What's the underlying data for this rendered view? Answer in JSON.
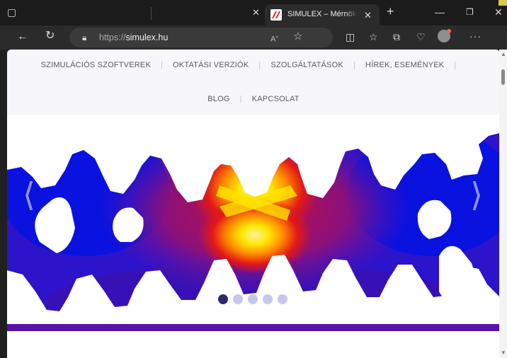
{
  "browser": {
    "tab_title": "SIMULEX – Mérnöki sz",
    "address": {
      "scheme": "https://",
      "host": "simulex.hu"
    }
  },
  "site": {
    "nav_row1": [
      {
        "label": "SZIMULÁCIÓS SZOFTVEREK"
      },
      {
        "label": "OKTATÁSI VERZIÓK"
      },
      {
        "label": "SZOLGÁLTATÁSOK"
      },
      {
        "label": "HÍREK, ESEMÉNYEK"
      }
    ],
    "nav_row2": [
      {
        "label": "BLOG"
      },
      {
        "label": "KAPCSOLAT"
      }
    ],
    "slider": {
      "dot_count": 5,
      "active_dot": 1
    }
  },
  "colors": {
    "field_blue": "#0a12e0",
    "field_purple": "#5a12a8",
    "field_red": "#c8102e",
    "field_yellow": "#ffe600",
    "brand_red": "#d3222a"
  },
  "icons": {
    "back": "arrow-left-icon",
    "reload": "reload-icon",
    "lock": "lock-icon",
    "star": "star-icon",
    "avatar": "profile-avatar-icon"
  }
}
